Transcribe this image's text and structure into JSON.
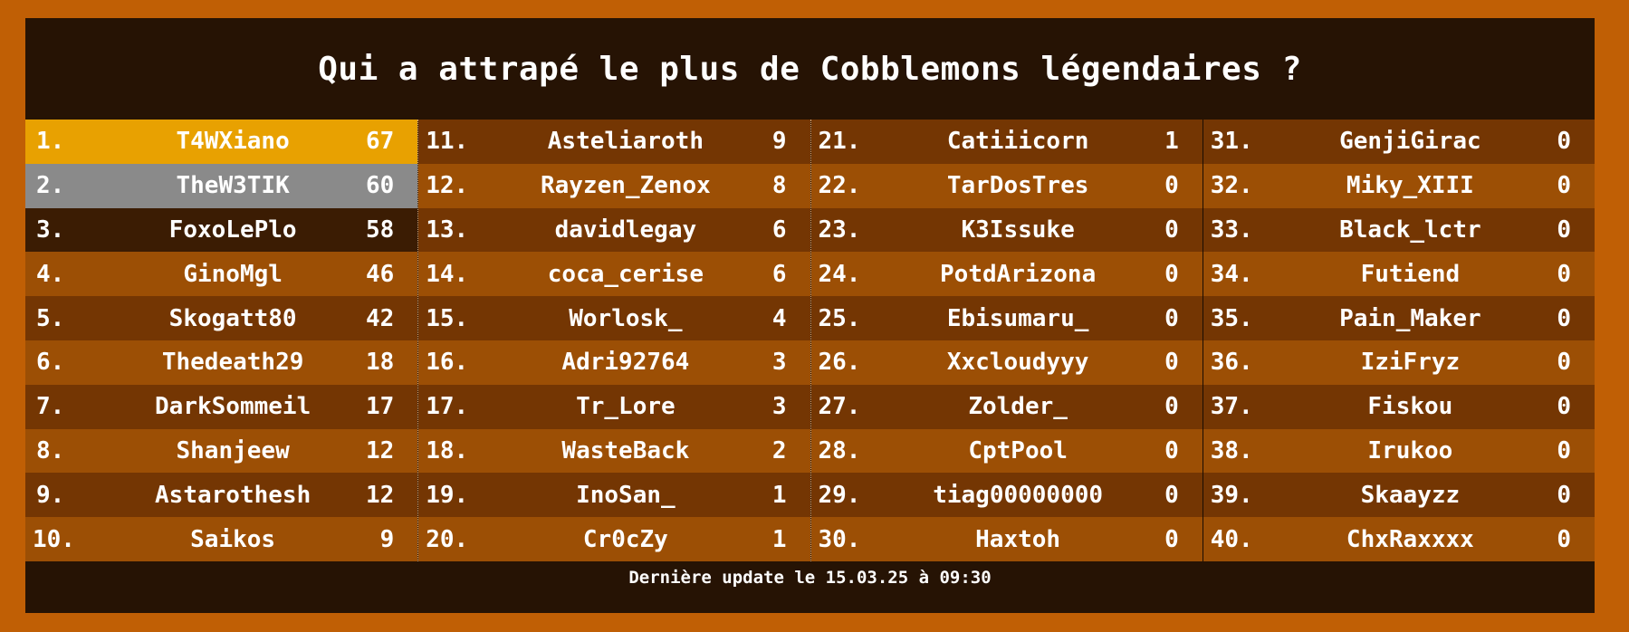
{
  "title": "Qui a attrapé le plus de Cobblemons légendaires ?",
  "footer": "Dernière update le 15.03.25 à 09:30",
  "columns": [
    [
      {
        "rank": "1.",
        "name": "T4WXiano",
        "count": "67"
      },
      {
        "rank": "2.",
        "name": "TheW3TIK",
        "count": "60"
      },
      {
        "rank": "3.",
        "name": "FoxoLePlo",
        "count": "58"
      },
      {
        "rank": "4.",
        "name": "GinoMgl",
        "count": "46"
      },
      {
        "rank": "5.",
        "name": "Skogatt80",
        "count": "42"
      },
      {
        "rank": "6.",
        "name": "Thedeath29",
        "count": "18"
      },
      {
        "rank": "7.",
        "name": "DarkSommeil",
        "count": "17"
      },
      {
        "rank": "8.",
        "name": "Shanjeew",
        "count": "12"
      },
      {
        "rank": "9.",
        "name": "Astarothesh",
        "count": "12"
      },
      {
        "rank": "10.",
        "name": "Saikos",
        "count": "9"
      }
    ],
    [
      {
        "rank": "11.",
        "name": "Asteliaroth",
        "count": "9"
      },
      {
        "rank": "12.",
        "name": "Rayzen_Zenox",
        "count": "8"
      },
      {
        "rank": "13.",
        "name": "davidlegay",
        "count": "6"
      },
      {
        "rank": "14.",
        "name": "coca_cerise",
        "count": "6"
      },
      {
        "rank": "15.",
        "name": "Worlosk_",
        "count": "4"
      },
      {
        "rank": "16.",
        "name": "Adri92764",
        "count": "3"
      },
      {
        "rank": "17.",
        "name": "Tr_Lore",
        "count": "3"
      },
      {
        "rank": "18.",
        "name": "WasteBack",
        "count": "2"
      },
      {
        "rank": "19.",
        "name": "InoSan_",
        "count": "1"
      },
      {
        "rank": "20.",
        "name": "Cr0cZy",
        "count": "1"
      }
    ],
    [
      {
        "rank": "21.",
        "name": "Catiiicorn",
        "count": "1"
      },
      {
        "rank": "22.",
        "name": "TarDosTres",
        "count": "0"
      },
      {
        "rank": "23.",
        "name": "K3Issuke",
        "count": "0"
      },
      {
        "rank": "24.",
        "name": "PotdArizona",
        "count": "0"
      },
      {
        "rank": "25.",
        "name": "Ebisumaru_",
        "count": "0"
      },
      {
        "rank": "26.",
        "name": "Xxcloudyyy",
        "count": "0"
      },
      {
        "rank": "27.",
        "name": "Zolder_",
        "count": "0"
      },
      {
        "rank": "28.",
        "name": "CptPool",
        "count": "0"
      },
      {
        "rank": "29.",
        "name": "tiag00000000",
        "count": "0"
      },
      {
        "rank": "30.",
        "name": "Haxtoh",
        "count": "0"
      }
    ],
    [
      {
        "rank": "31.",
        "name": "GenjiGirac",
        "count": "0"
      },
      {
        "rank": "32.",
        "name": "Miky_XIII",
        "count": "0"
      },
      {
        "rank": "33.",
        "name": "Black_lctr",
        "count": "0"
      },
      {
        "rank": "34.",
        "name": "Futiend",
        "count": "0"
      },
      {
        "rank": "35.",
        "name": "Pain_Maker",
        "count": "0"
      },
      {
        "rank": "36.",
        "name": "IziFryz",
        "count": "0"
      },
      {
        "rank": "37.",
        "name": "Fiskou",
        "count": "0"
      },
      {
        "rank": "38.",
        "name": "Irukoo",
        "count": "0"
      },
      {
        "rank": "39.",
        "name": "Skaayzz",
        "count": "0"
      },
      {
        "rank": "40.",
        "name": "ChxRaxxxx",
        "count": "0"
      }
    ]
  ],
  "colors": {
    "frame": "#c05f05",
    "panel": "#261304",
    "gold": "#e8a101",
    "silver": "#8a8a8a",
    "bronze": "#3b1c03",
    "row_dark": "#743603",
    "row_light": "#9c4f05",
    "text": "#ffffff"
  }
}
